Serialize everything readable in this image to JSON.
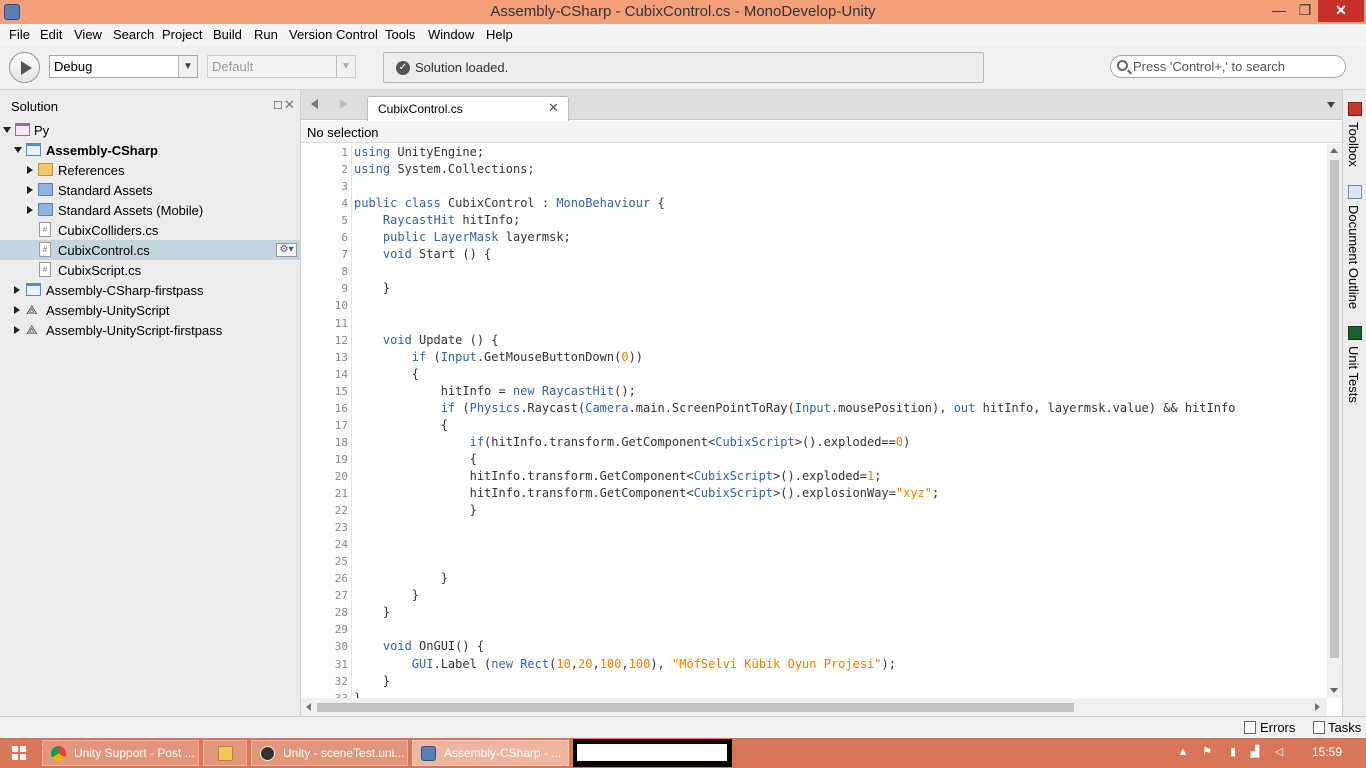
{
  "window": {
    "title": "Assembly-CSharp - CubixControl.cs - MonoDevelop-Unity",
    "min": "—",
    "max": "❐",
    "close": "✕"
  },
  "menu": [
    "File",
    "Edit",
    "View",
    "Search",
    "Project",
    "Build",
    "Run",
    "Version Control",
    "Tools",
    "Window",
    "Help"
  ],
  "toolbar": {
    "configuration": "Debug",
    "platform": "Default",
    "status": "Solution loaded.",
    "search_placeholder": "Press 'Control+,' to search"
  },
  "solution_pad": {
    "title": "Solution",
    "items": [
      {
        "label": "Py",
        "icon": "solution-icon",
        "expander": "down",
        "bold": false,
        "selected": false
      },
      {
        "label": "Assembly-CSharp",
        "icon": "project-icon",
        "expander": "down",
        "bold": true,
        "selected": false
      },
      {
        "label": "References",
        "icon": "folder-icon",
        "expander": "right",
        "bold": false,
        "selected": false
      },
      {
        "label": "Standard Assets",
        "icon": "folder-blue-icon",
        "expander": "right",
        "bold": false,
        "selected": false
      },
      {
        "label": "Standard Assets (Mobile)",
        "icon": "folder-blue-icon",
        "expander": "right",
        "bold": false,
        "selected": false
      },
      {
        "label": "CubixColliders.cs",
        "icon": "csharp-file-icon",
        "expander": "none",
        "bold": false,
        "selected": false
      },
      {
        "label": "CubixControl.cs",
        "icon": "csharp-file-icon",
        "expander": "none",
        "bold": false,
        "selected": true
      },
      {
        "label": "CubixScript.cs",
        "icon": "csharp-file-icon",
        "expander": "none",
        "bold": false,
        "selected": false
      },
      {
        "label": "Assembly-CSharp-firstpass",
        "icon": "project-icon",
        "expander": "right",
        "bold": false,
        "selected": false
      },
      {
        "label": "Assembly-UnityScript",
        "icon": "unity-icon",
        "expander": "right",
        "bold": false,
        "selected": false
      },
      {
        "label": "Assembly-UnityScript-firstpass",
        "icon": "unity-icon",
        "expander": "right",
        "bold": false,
        "selected": false
      }
    ]
  },
  "editor": {
    "tab": "CubixControl.cs",
    "path": "No selection",
    "lines": [
      "using UnityEngine;",
      "using System.Collections;",
      "",
      "public class CubixControl : MonoBehaviour {",
      "    RaycastHit hitInfo;",
      "    public LayerMask layermsk;",
      "    void Start () {",
      "",
      "    }",
      "",
      "",
      "    void Update () {",
      "        if (Input.GetMouseButtonDown(0))",
      "        {",
      "            hitInfo = new RaycastHit();",
      "            if (Physics.Raycast(Camera.main.ScreenPointToRay(Input.mousePosition), out hitInfo, layermsk.value) && hitInfo",
      "            {",
      "                if(hitInfo.transform.GetComponent<CubixScript>().exploded==0)",
      "                {",
      "                hitInfo.transform.GetComponent<CubixScript>().exploded=1;",
      "                hitInfo.transform.GetComponent<CubixScript>().explosionWay=\"xyz\";",
      "                }",
      "",
      "",
      "",
      "            }",
      "        }",
      "    }",
      "",
      "    void OnGUI() {",
      "        GUI.Label (new Rect(10,20,100,100), \"MöfSelvi Kübik Oyun Projesi\");",
      "    }",
      "}"
    ]
  },
  "right_dock": [
    "Toolbox",
    "Document Outline",
    "Unit Tests"
  ],
  "statusbar": {
    "errors": "Errors",
    "tasks": "Tasks"
  },
  "taskbar": {
    "items": [
      {
        "label": "Unity Support - Post ...",
        "icon": "chrome-icon"
      },
      {
        "label": "",
        "icon": "file-explorer-icon"
      },
      {
        "label": "Unity - sceneTest.uni...",
        "icon": "unity-icon"
      },
      {
        "label": "Assembly-CSharp - ...",
        "icon": "monodevelop-icon"
      }
    ],
    "clock": "15:59"
  },
  "colors": {
    "titlebar": "#f3a07a",
    "taskbar": "#d8765a",
    "keyword": "#3364a4",
    "literal": "#f57d00",
    "selection": "#c5d5df"
  }
}
